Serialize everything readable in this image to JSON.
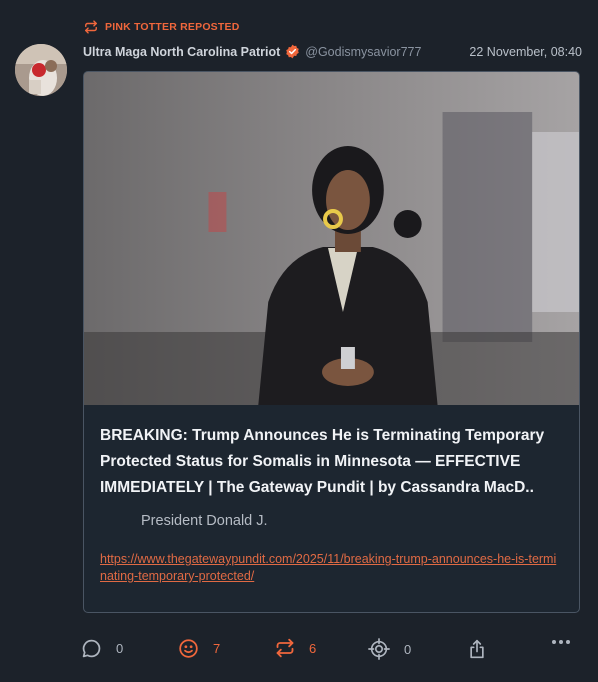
{
  "repost": {
    "label": "PINK TOTTER REPOSTED"
  },
  "post": {
    "author_name": "Ultra Maga North Carolina Patriot",
    "handle": "@Godismysavior777",
    "timestamp": "22 November, 08:40"
  },
  "card": {
    "title": "BREAKING: Trump Announces He is Terminating Temporary Protected Status for Somalis in Minnesota — EFFECTIVE IMMEDIATELY | The Gateway Pundit | by Cassandra MacD..",
    "description": "President Donald J.",
    "link": "https://www.thegatewaypundit.com/2025/11/breaking-trump-announces-he-is-terminating-temporary-protected/"
  },
  "actions": {
    "replies": "0",
    "reactions": "7",
    "reposts": "6",
    "zaps": "0"
  },
  "colors": {
    "accent": "#f0673c",
    "background": "#1c222a",
    "card_border": "#4a5563",
    "verified_badge": "#f0673c"
  },
  "icons": [
    "repost-icon",
    "verified-badge-icon",
    "reply-icon",
    "reaction-icon",
    "repost-icon",
    "target-icon",
    "share-icon",
    "more-icon"
  ]
}
